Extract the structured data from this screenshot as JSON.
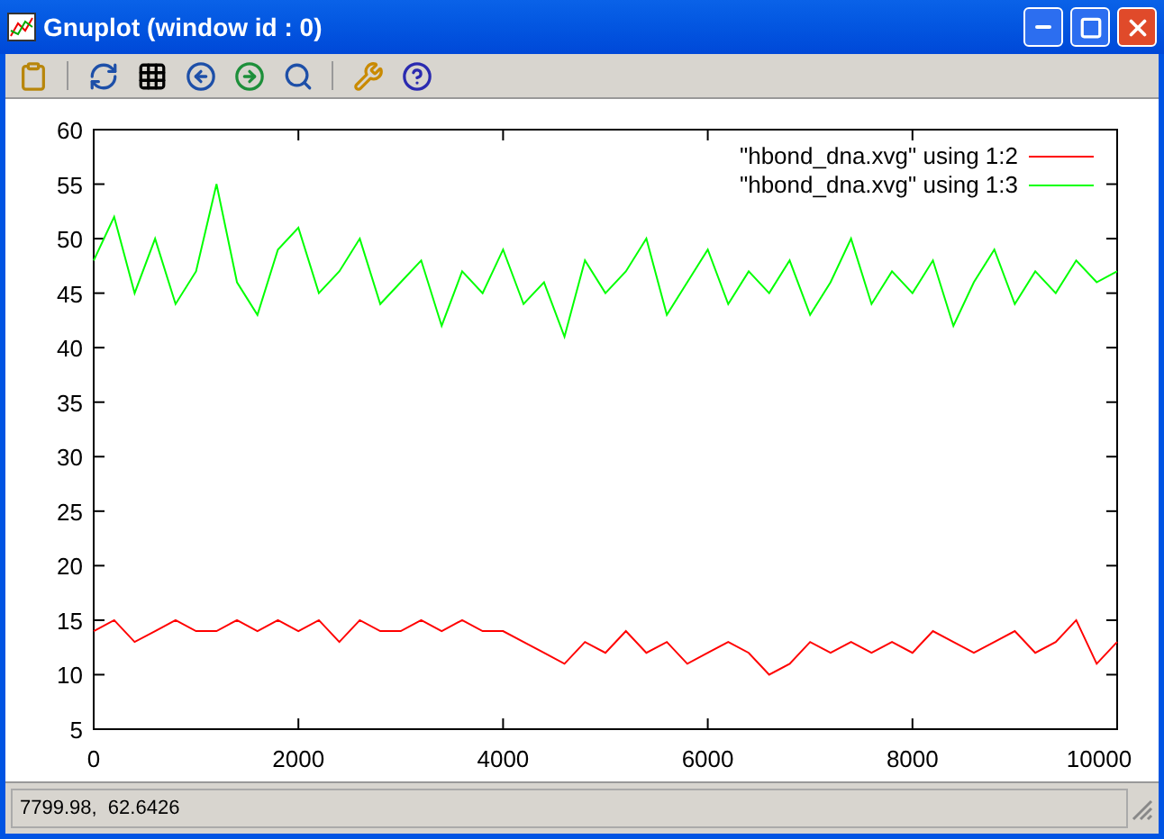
{
  "window": {
    "title": "Gnuplot (window id : 0)"
  },
  "plot": {
    "chart_data": {
      "type": "line",
      "x": [
        0,
        200,
        400,
        600,
        800,
        1000,
        1200,
        1400,
        1600,
        1800,
        2000,
        2200,
        2400,
        2600,
        2800,
        3000,
        3200,
        3400,
        3600,
        3800,
        4000,
        4200,
        4400,
        4600,
        4800,
        5000,
        5200,
        5400,
        5600,
        5800,
        6000,
        6200,
        6400,
        6600,
        6800,
        7000,
        7200,
        7400,
        7600,
        7800,
        8000,
        8200,
        8400,
        8600,
        8800,
        9000,
        9200,
        9400,
        9600,
        9800,
        10000
      ],
      "series": [
        {
          "name": "\"hbond_dna.xvg\" using 1:2",
          "color": "#ff0000",
          "values": [
            14,
            15,
            13,
            14,
            15,
            14,
            14,
            15,
            14,
            15,
            14,
            15,
            13,
            15,
            14,
            14,
            15,
            14,
            15,
            14,
            14,
            13,
            12,
            11,
            13,
            12,
            14,
            12,
            13,
            11,
            12,
            13,
            12,
            10,
            11,
            13,
            12,
            13,
            12,
            13,
            12,
            14,
            13,
            12,
            13,
            14,
            12,
            13,
            15,
            11,
            13
          ]
        },
        {
          "name": "\"hbond_dna.xvg\" using 1:3",
          "color": "#00ff00",
          "values": [
            48,
            52,
            45,
            50,
            44,
            47,
            55,
            46,
            43,
            49,
            51,
            45,
            47,
            50,
            44,
            46,
            48,
            42,
            47,
            45,
            49,
            44,
            46,
            41,
            48,
            45,
            47,
            50,
            43,
            46,
            49,
            44,
            47,
            45,
            48,
            43,
            46,
            50,
            44,
            47,
            45,
            48,
            42,
            46,
            49,
            44,
            47,
            45,
            48,
            46,
            47
          ]
        }
      ],
      "legend": "top right",
      "xlim": [
        0,
        10000
      ],
      "ylim": [
        5,
        60
      ],
      "xticks": [
        0,
        2000,
        4000,
        6000,
        8000,
        10000
      ],
      "yticks": [
        5,
        10,
        15,
        20,
        25,
        30,
        35,
        40,
        45,
        50,
        55,
        60
      ]
    }
  },
  "status_bar": {
    "text": "7799.98,  62.6426"
  }
}
